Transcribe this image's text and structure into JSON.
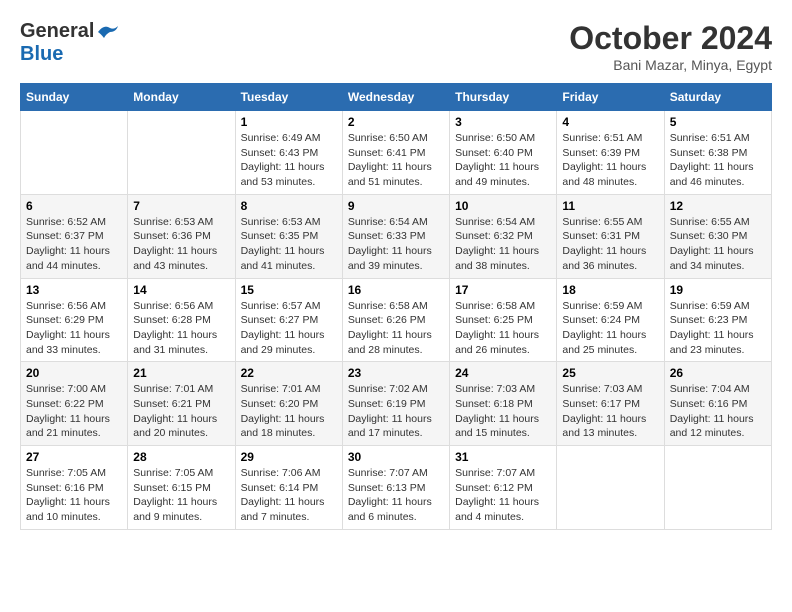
{
  "header": {
    "logo_general": "General",
    "logo_blue": "Blue",
    "month_title": "October 2024",
    "location": "Bani Mazar, Minya, Egypt"
  },
  "weekdays": [
    "Sunday",
    "Monday",
    "Tuesday",
    "Wednesday",
    "Thursday",
    "Friday",
    "Saturday"
  ],
  "weeks": [
    [
      {
        "day": "",
        "sunrise": "",
        "sunset": "",
        "daylight": ""
      },
      {
        "day": "",
        "sunrise": "",
        "sunset": "",
        "daylight": ""
      },
      {
        "day": "1",
        "sunrise": "Sunrise: 6:49 AM",
        "sunset": "Sunset: 6:43 PM",
        "daylight": "Daylight: 11 hours and 53 minutes."
      },
      {
        "day": "2",
        "sunrise": "Sunrise: 6:50 AM",
        "sunset": "Sunset: 6:41 PM",
        "daylight": "Daylight: 11 hours and 51 minutes."
      },
      {
        "day": "3",
        "sunrise": "Sunrise: 6:50 AM",
        "sunset": "Sunset: 6:40 PM",
        "daylight": "Daylight: 11 hours and 49 minutes."
      },
      {
        "day": "4",
        "sunrise": "Sunrise: 6:51 AM",
        "sunset": "Sunset: 6:39 PM",
        "daylight": "Daylight: 11 hours and 48 minutes."
      },
      {
        "day": "5",
        "sunrise": "Sunrise: 6:51 AM",
        "sunset": "Sunset: 6:38 PM",
        "daylight": "Daylight: 11 hours and 46 minutes."
      }
    ],
    [
      {
        "day": "6",
        "sunrise": "Sunrise: 6:52 AM",
        "sunset": "Sunset: 6:37 PM",
        "daylight": "Daylight: 11 hours and 44 minutes."
      },
      {
        "day": "7",
        "sunrise": "Sunrise: 6:53 AM",
        "sunset": "Sunset: 6:36 PM",
        "daylight": "Daylight: 11 hours and 43 minutes."
      },
      {
        "day": "8",
        "sunrise": "Sunrise: 6:53 AM",
        "sunset": "Sunset: 6:35 PM",
        "daylight": "Daylight: 11 hours and 41 minutes."
      },
      {
        "day": "9",
        "sunrise": "Sunrise: 6:54 AM",
        "sunset": "Sunset: 6:33 PM",
        "daylight": "Daylight: 11 hours and 39 minutes."
      },
      {
        "day": "10",
        "sunrise": "Sunrise: 6:54 AM",
        "sunset": "Sunset: 6:32 PM",
        "daylight": "Daylight: 11 hours and 38 minutes."
      },
      {
        "day": "11",
        "sunrise": "Sunrise: 6:55 AM",
        "sunset": "Sunset: 6:31 PM",
        "daylight": "Daylight: 11 hours and 36 minutes."
      },
      {
        "day": "12",
        "sunrise": "Sunrise: 6:55 AM",
        "sunset": "Sunset: 6:30 PM",
        "daylight": "Daylight: 11 hours and 34 minutes."
      }
    ],
    [
      {
        "day": "13",
        "sunrise": "Sunrise: 6:56 AM",
        "sunset": "Sunset: 6:29 PM",
        "daylight": "Daylight: 11 hours and 33 minutes."
      },
      {
        "day": "14",
        "sunrise": "Sunrise: 6:56 AM",
        "sunset": "Sunset: 6:28 PM",
        "daylight": "Daylight: 11 hours and 31 minutes."
      },
      {
        "day": "15",
        "sunrise": "Sunrise: 6:57 AM",
        "sunset": "Sunset: 6:27 PM",
        "daylight": "Daylight: 11 hours and 29 minutes."
      },
      {
        "day": "16",
        "sunrise": "Sunrise: 6:58 AM",
        "sunset": "Sunset: 6:26 PM",
        "daylight": "Daylight: 11 hours and 28 minutes."
      },
      {
        "day": "17",
        "sunrise": "Sunrise: 6:58 AM",
        "sunset": "Sunset: 6:25 PM",
        "daylight": "Daylight: 11 hours and 26 minutes."
      },
      {
        "day": "18",
        "sunrise": "Sunrise: 6:59 AM",
        "sunset": "Sunset: 6:24 PM",
        "daylight": "Daylight: 11 hours and 25 minutes."
      },
      {
        "day": "19",
        "sunrise": "Sunrise: 6:59 AM",
        "sunset": "Sunset: 6:23 PM",
        "daylight": "Daylight: 11 hours and 23 minutes."
      }
    ],
    [
      {
        "day": "20",
        "sunrise": "Sunrise: 7:00 AM",
        "sunset": "Sunset: 6:22 PM",
        "daylight": "Daylight: 11 hours and 21 minutes."
      },
      {
        "day": "21",
        "sunrise": "Sunrise: 7:01 AM",
        "sunset": "Sunset: 6:21 PM",
        "daylight": "Daylight: 11 hours and 20 minutes."
      },
      {
        "day": "22",
        "sunrise": "Sunrise: 7:01 AM",
        "sunset": "Sunset: 6:20 PM",
        "daylight": "Daylight: 11 hours and 18 minutes."
      },
      {
        "day": "23",
        "sunrise": "Sunrise: 7:02 AM",
        "sunset": "Sunset: 6:19 PM",
        "daylight": "Daylight: 11 hours and 17 minutes."
      },
      {
        "day": "24",
        "sunrise": "Sunrise: 7:03 AM",
        "sunset": "Sunset: 6:18 PM",
        "daylight": "Daylight: 11 hours and 15 minutes."
      },
      {
        "day": "25",
        "sunrise": "Sunrise: 7:03 AM",
        "sunset": "Sunset: 6:17 PM",
        "daylight": "Daylight: 11 hours and 13 minutes."
      },
      {
        "day": "26",
        "sunrise": "Sunrise: 7:04 AM",
        "sunset": "Sunset: 6:16 PM",
        "daylight": "Daylight: 11 hours and 12 minutes."
      }
    ],
    [
      {
        "day": "27",
        "sunrise": "Sunrise: 7:05 AM",
        "sunset": "Sunset: 6:16 PM",
        "daylight": "Daylight: 11 hours and 10 minutes."
      },
      {
        "day": "28",
        "sunrise": "Sunrise: 7:05 AM",
        "sunset": "Sunset: 6:15 PM",
        "daylight": "Daylight: 11 hours and 9 minutes."
      },
      {
        "day": "29",
        "sunrise": "Sunrise: 7:06 AM",
        "sunset": "Sunset: 6:14 PM",
        "daylight": "Daylight: 11 hours and 7 minutes."
      },
      {
        "day": "30",
        "sunrise": "Sunrise: 7:07 AM",
        "sunset": "Sunset: 6:13 PM",
        "daylight": "Daylight: 11 hours and 6 minutes."
      },
      {
        "day": "31",
        "sunrise": "Sunrise: 7:07 AM",
        "sunset": "Sunset: 6:12 PM",
        "daylight": "Daylight: 11 hours and 4 minutes."
      },
      {
        "day": "",
        "sunrise": "",
        "sunset": "",
        "daylight": ""
      },
      {
        "day": "",
        "sunrise": "",
        "sunset": "",
        "daylight": ""
      }
    ]
  ]
}
